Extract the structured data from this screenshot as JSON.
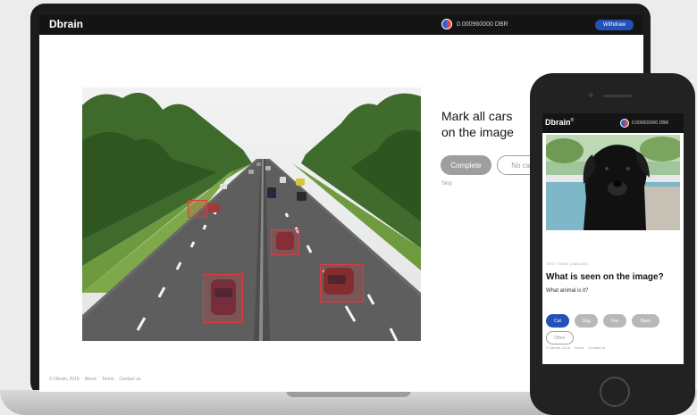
{
  "laptop": {
    "app": {
      "logo": "Dbrain",
      "balance": "0.000960000 DBR",
      "withdraw_label": "Withdraw"
    },
    "task": {
      "title_line1": "Mark all cars",
      "title_line2": "on the image",
      "complete_label": "Complete",
      "no_cars_label": "No cars",
      "skip_label": "Skip"
    },
    "footer": {
      "copyright": "© Dbrain, 2018",
      "links": [
        "About",
        "Terms",
        "Contact us"
      ]
    }
  },
  "phone": {
    "app": {
      "logo": "Dbrain",
      "logo_super": "®",
      "balance": "0.000000000 DBR"
    },
    "task": {
      "counter": "TEST TASK (158/220)",
      "question": "What is seen on the image?",
      "sub": "What animal is it?",
      "options": [
        "Cat",
        "Dog",
        "Fox",
        "Bass",
        "Other"
      ],
      "selected": "Cat"
    },
    "footer": {
      "copyright": "© Dbrain, 2018",
      "links": [
        "About",
        "Contact us"
      ]
    }
  },
  "colors": {
    "accent": "#2451b8",
    "box": "#e0393f",
    "dark": "#141414",
    "muted": "#9e9e9e"
  }
}
